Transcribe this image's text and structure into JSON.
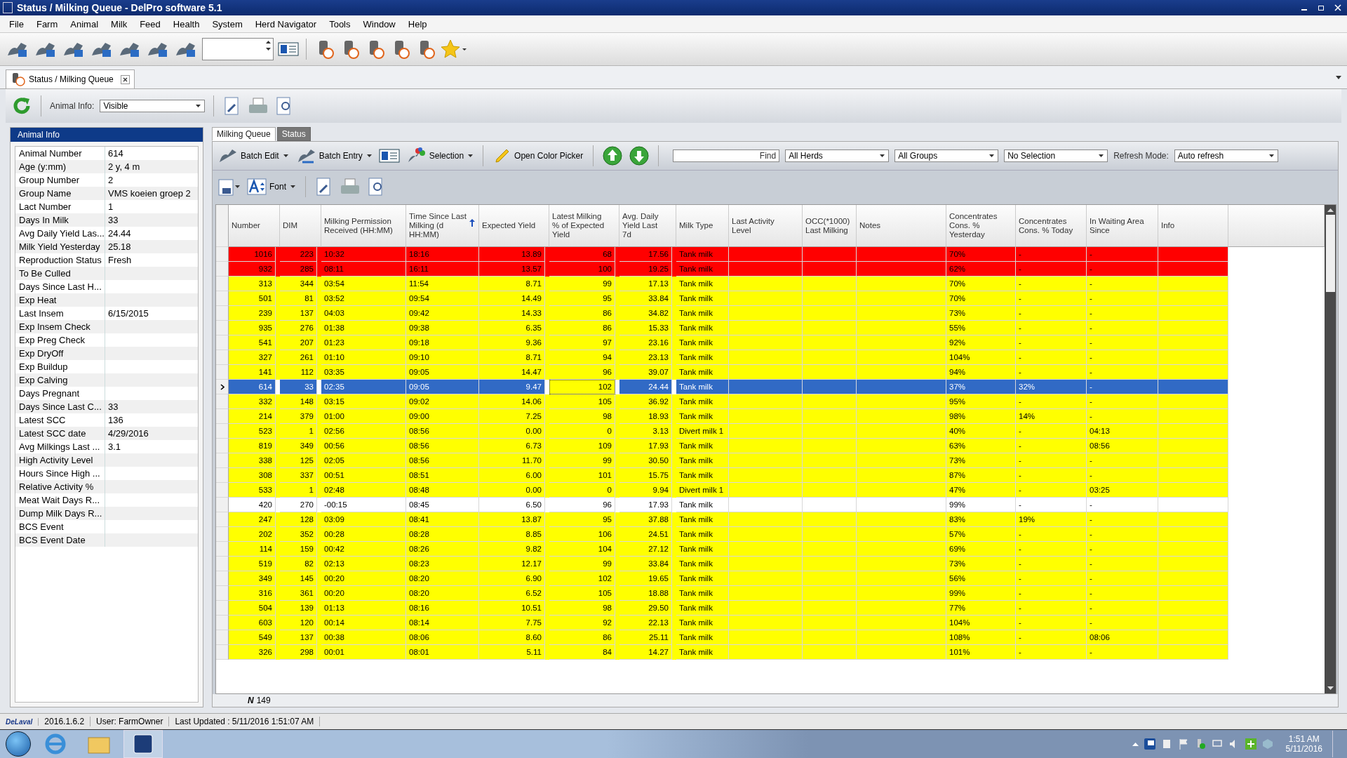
{
  "window": {
    "title": "Status / Milking Queue - DelPro software 5.1"
  },
  "menu": [
    "File",
    "Farm",
    "Animal",
    "Milk",
    "Feed",
    "Health",
    "System",
    "Herd Navigator",
    "Tools",
    "Window",
    "Help"
  ],
  "document_tab": {
    "label": "Status / Milking Queue"
  },
  "animal_info_selector": {
    "label": "Animal Info:",
    "value": "Visible"
  },
  "animal_info": {
    "title": "Animal Info",
    "fields": [
      {
        "label": "Animal Number",
        "value": "614"
      },
      {
        "label": "Age (y:mm)",
        "value": "2 y, 4 m"
      },
      {
        "label": "Group Number",
        "value": "2"
      },
      {
        "label": "Group Name",
        "value": "VMS koeien groep 2"
      },
      {
        "label": "Lact Number",
        "value": "1"
      },
      {
        "label": "Days In Milk",
        "value": "33"
      },
      {
        "label": "Avg Daily Yield Las...",
        "value": "24.44"
      },
      {
        "label": "Milk Yield Yesterday",
        "value": "25.18"
      },
      {
        "label": "Reproduction Status",
        "value": "Fresh"
      },
      {
        "label": "To Be Culled"
      },
      {
        "label": "Days Since Last H..."
      },
      {
        "label": "Exp Heat"
      },
      {
        "label": "Last Insem",
        "value": "6/15/2015"
      },
      {
        "label": "Exp Insem Check"
      },
      {
        "label": "Exp Preg Check"
      },
      {
        "label": "Exp DryOff"
      },
      {
        "label": "Exp Buildup"
      },
      {
        "label": "Exp Calving"
      },
      {
        "label": "Days Pregnant"
      },
      {
        "label": "Days Since Last C...",
        "value": "33"
      },
      {
        "label": "Latest SCC",
        "value": "136"
      },
      {
        "label": "Latest SCC date",
        "value": "4/29/2016"
      },
      {
        "label": "Avg Milkings Last ...",
        "value": "3.1"
      },
      {
        "label": "High Activity Level"
      },
      {
        "label": "Hours Since High ..."
      },
      {
        "label": "Relative Activity %"
      },
      {
        "label": "Meat Wait Days R..."
      },
      {
        "label": "Dump Milk Days R..."
      },
      {
        "label": "BCS Event"
      },
      {
        "label": "BCS Event Date"
      }
    ]
  },
  "view_tabs": [
    {
      "label": "Milking Queue",
      "selected": true
    },
    {
      "label": "Status",
      "selected": false
    }
  ],
  "grid_toolbar": {
    "batch_edit": "Batch Edit",
    "batch_entry": "Batch Entry",
    "selection": "Selection",
    "color_picker": "Open Color Picker",
    "find": "Find",
    "filters": [
      "All Herds",
      "All Groups",
      "No Selection"
    ],
    "refresh_label": "Refresh Mode:",
    "refresh_value": "Auto refresh",
    "font": "Font"
  },
  "table": {
    "columns": [
      {
        "label": "Number"
      },
      {
        "label": "DIM"
      },
      {
        "label": "Milking Permission Received (HH:MM)"
      },
      {
        "label": "Time Since Last Milking (d HH:MM)",
        "sorted": true
      },
      {
        "label": "Expected Yield"
      },
      {
        "label": "Latest Milking % of Expected Yield"
      },
      {
        "label": "Avg. Daily Yield Last 7d"
      },
      {
        "label": "Milk Type"
      },
      {
        "label": "Last Activity Level"
      },
      {
        "label": "OCC(*1000) Last Milking"
      },
      {
        "label": "Notes"
      },
      {
        "label": "Concentrates Cons. % Yesterday"
      },
      {
        "label": "Concentrates Cons. % Today"
      },
      {
        "label": "In Waiting Area Since"
      },
      {
        "label": "Info"
      }
    ],
    "rows": [
      {
        "number": "1016",
        "dim": "223",
        "permission": "10:32",
        "since_last": "18:16",
        "expected": "13.89",
        "latest_pct": "68",
        "avg_7d": "17.56",
        "milk_type": "Tank milk",
        "conc_yesterday": "70%",
        "conc_today": "-",
        "waiting": "-",
        "color": "#ff0000",
        "selected": false
      },
      {
        "number": "932",
        "dim": "285",
        "permission": "08:11",
        "since_last": "16:11",
        "expected": "13.57",
        "latest_pct": "100",
        "avg_7d": "19.25",
        "milk_type": "Tank milk",
        "conc_yesterday": "62%",
        "conc_today": "-",
        "waiting": "-",
        "color": "#ff0000",
        "selected": false
      },
      {
        "number": "313",
        "dim": "344",
        "permission": "03:54",
        "since_last": "11:54",
        "expected": "8.71",
        "latest_pct": "99",
        "avg_7d": "17.13",
        "milk_type": "Tank milk",
        "conc_yesterday": "70%",
        "conc_today": "-",
        "waiting": "-",
        "color": "#ffff00",
        "selected": false
      },
      {
        "number": "501",
        "dim": "81",
        "permission": "03:52",
        "since_last": "09:54",
        "expected": "14.49",
        "latest_pct": "95",
        "avg_7d": "33.84",
        "milk_type": "Tank milk",
        "conc_yesterday": "70%",
        "conc_today": "-",
        "waiting": "-",
        "color": "#ffff00",
        "selected": false
      },
      {
        "number": "239",
        "dim": "137",
        "permission": "04:03",
        "since_last": "09:42",
        "expected": "14.33",
        "latest_pct": "86",
        "avg_7d": "34.82",
        "milk_type": "Tank milk",
        "conc_yesterday": "73%",
        "conc_today": "-",
        "waiting": "-",
        "color": "#ffff00",
        "selected": false
      },
      {
        "number": "935",
        "dim": "276",
        "permission": "01:38",
        "since_last": "09:38",
        "expected": "6.35",
        "latest_pct": "86",
        "avg_7d": "15.33",
        "milk_type": "Tank milk",
        "conc_yesterday": "55%",
        "conc_today": "-",
        "waiting": "-",
        "color": "#ffff00",
        "selected": false
      },
      {
        "number": "541",
        "dim": "207",
        "permission": "01:23",
        "since_last": "09:18",
        "expected": "9.36",
        "latest_pct": "97",
        "avg_7d": "23.16",
        "milk_type": "Tank milk",
        "conc_yesterday": "92%",
        "conc_today": "-",
        "waiting": "-",
        "color": "#ffff00",
        "selected": false
      },
      {
        "number": "327",
        "dim": "261",
        "permission": "01:10",
        "since_last": "09:10",
        "expected": "8.71",
        "latest_pct": "94",
        "avg_7d": "23.13",
        "milk_type": "Tank milk",
        "conc_yesterday": "104%",
        "conc_today": "-",
        "waiting": "-",
        "color": "#ffff00",
        "selected": false
      },
      {
        "number": "141",
        "dim": "112",
        "permission": "03:35",
        "since_last": "09:05",
        "expected": "14.47",
        "latest_pct": "96",
        "avg_7d": "39.07",
        "milk_type": "Tank milk",
        "conc_yesterday": "94%",
        "conc_today": "-",
        "waiting": "-",
        "color": "#ffff00",
        "selected": false
      },
      {
        "number": "614",
        "dim": "33",
        "permission": "02:35",
        "since_last": "09:05",
        "expected": "9.47",
        "latest_pct": "102",
        "avg_7d": "24.44",
        "milk_type": "Tank milk",
        "conc_yesterday": "37%",
        "conc_today": "32%",
        "waiting": "-",
        "color": "#ffff00",
        "selected": true
      },
      {
        "number": "332",
        "dim": "148",
        "permission": "03:15",
        "since_last": "09:02",
        "expected": "14.06",
        "latest_pct": "105",
        "avg_7d": "36.92",
        "milk_type": "Tank milk",
        "conc_yesterday": "95%",
        "conc_today": "-",
        "waiting": "-",
        "color": "#ffff00",
        "selected": false
      },
      {
        "number": "214",
        "dim": "379",
        "permission": "01:00",
        "since_last": "09:00",
        "expected": "7.25",
        "latest_pct": "98",
        "avg_7d": "18.93",
        "milk_type": "Tank milk",
        "conc_yesterday": "98%",
        "conc_today": "14%",
        "waiting": "-",
        "color": "#ffff00",
        "selected": false
      },
      {
        "number": "523",
        "dim": "1",
        "permission": "02:56",
        "since_last": "08:56",
        "expected": "0.00",
        "latest_pct": "0",
        "avg_7d": "3.13",
        "milk_type": "Divert milk 1",
        "conc_yesterday": "40%",
        "conc_today": "-",
        "waiting": "04:13",
        "color": "#ffff00",
        "selected": false
      },
      {
        "number": "819",
        "dim": "349",
        "permission": "00:56",
        "since_last": "08:56",
        "expected": "6.73",
        "latest_pct": "109",
        "avg_7d": "17.93",
        "milk_type": "Tank milk",
        "conc_yesterday": "63%",
        "conc_today": "-",
        "waiting": "08:56",
        "color": "#ffff00",
        "selected": false
      },
      {
        "number": "338",
        "dim": "125",
        "permission": "02:05",
        "since_last": "08:56",
        "expected": "11.70",
        "latest_pct": "99",
        "avg_7d": "30.50",
        "milk_type": "Tank milk",
        "conc_yesterday": "73%",
        "conc_today": "-",
        "waiting": "-",
        "color": "#ffff00",
        "selected": false
      },
      {
        "number": "308",
        "dim": "337",
        "permission": "00:51",
        "since_last": "08:51",
        "expected": "6.00",
        "latest_pct": "101",
        "avg_7d": "15.75",
        "milk_type": "Tank milk",
        "conc_yesterday": "87%",
        "conc_today": "-",
        "waiting": "-",
        "color": "#ffff00",
        "selected": false
      },
      {
        "number": "533",
        "dim": "1",
        "permission": "02:48",
        "since_last": "08:48",
        "expected": "0.00",
        "latest_pct": "0",
        "avg_7d": "9.94",
        "milk_type": "Divert milk 1",
        "conc_yesterday": "47%",
        "conc_today": "-",
        "waiting": "03:25",
        "color": "#ffff00",
        "selected": false
      },
      {
        "number": "420",
        "dim": "270",
        "permission": "-00:15",
        "since_last": "08:45",
        "expected": "6.50",
        "latest_pct": "96",
        "avg_7d": "17.93",
        "milk_type": "Tank milk",
        "conc_yesterday": "99%",
        "conc_today": "-",
        "waiting": "-",
        "color": "#ffffff",
        "selected": false
      },
      {
        "number": "247",
        "dim": "128",
        "permission": "03:09",
        "since_last": "08:41",
        "expected": "13.87",
        "latest_pct": "95",
        "avg_7d": "37.88",
        "milk_type": "Tank milk",
        "conc_yesterday": "83%",
        "conc_today": "19%",
        "waiting": "-",
        "color": "#ffff00",
        "selected": false
      },
      {
        "number": "202",
        "dim": "352",
        "permission": "00:28",
        "since_last": "08:28",
        "expected": "8.85",
        "latest_pct": "106",
        "avg_7d": "24.51",
        "milk_type": "Tank milk",
        "conc_yesterday": "57%",
        "conc_today": "-",
        "waiting": "-",
        "color": "#ffff00",
        "selected": false
      },
      {
        "number": "114",
        "dim": "159",
        "permission": "00:42",
        "since_last": "08:26",
        "expected": "9.82",
        "latest_pct": "104",
        "avg_7d": "27.12",
        "milk_type": "Tank milk",
        "conc_yesterday": "69%",
        "conc_today": "-",
        "waiting": "-",
        "color": "#ffff00",
        "selected": false
      },
      {
        "number": "519",
        "dim": "82",
        "permission": "02:13",
        "since_last": "08:23",
        "expected": "12.17",
        "latest_pct": "99",
        "avg_7d": "33.84",
        "milk_type": "Tank milk",
        "conc_yesterday": "73%",
        "conc_today": "-",
        "waiting": "-",
        "color": "#ffff00",
        "selected": false
      },
      {
        "number": "349",
        "dim": "145",
        "permission": "00:20",
        "since_last": "08:20",
        "expected": "6.90",
        "latest_pct": "102",
        "avg_7d": "19.65",
        "milk_type": "Tank milk",
        "conc_yesterday": "56%",
        "conc_today": "-",
        "waiting": "-",
        "color": "#ffff00",
        "selected": false
      },
      {
        "number": "316",
        "dim": "361",
        "permission": "00:20",
        "since_last": "08:20",
        "expected": "6.52",
        "latest_pct": "105",
        "avg_7d": "18.88",
        "milk_type": "Tank milk",
        "conc_yesterday": "99%",
        "conc_today": "-",
        "waiting": "-",
        "color": "#ffff00",
        "selected": false
      },
      {
        "number": "504",
        "dim": "139",
        "permission": "01:13",
        "since_last": "08:16",
        "expected": "10.51",
        "latest_pct": "98",
        "avg_7d": "29.50",
        "milk_type": "Tank milk",
        "conc_yesterday": "77%",
        "conc_today": "-",
        "waiting": "-",
        "color": "#ffff00",
        "selected": false
      },
      {
        "number": "603",
        "dim": "120",
        "permission": "00:14",
        "since_last": "08:14",
        "expected": "7.75",
        "latest_pct": "92",
        "avg_7d": "22.13",
        "milk_type": "Tank milk",
        "conc_yesterday": "104%",
        "conc_today": "-",
        "waiting": "-",
        "color": "#ffff00",
        "selected": false
      },
      {
        "number": "549",
        "dim": "137",
        "permission": "00:38",
        "since_last": "08:06",
        "expected": "8.60",
        "latest_pct": "86",
        "avg_7d": "25.11",
        "milk_type": "Tank milk",
        "conc_yesterday": "108%",
        "conc_today": "-",
        "waiting": "08:06",
        "color": "#ffff00",
        "selected": false
      },
      {
        "number": "326",
        "dim": "298",
        "permission": "00:01",
        "since_last": "08:01",
        "expected": "5.11",
        "latest_pct": "84",
        "avg_7d": "14.27",
        "milk_type": "Tank milk",
        "conc_yesterday": "101%",
        "conc_today": "-",
        "waiting": "-",
        "color": "#ffff00",
        "selected": false
      }
    ],
    "footer": {
      "count_label": "N",
      "count": "149"
    }
  },
  "status_bar": {
    "brand": "DeLaval",
    "version": "2016.1.6.2",
    "user": "User: FarmOwner",
    "last_updated": "Last Updated : 5/11/2016 1:51:07 AM"
  },
  "taskbar": {
    "time": "1:51 AM",
    "date": "5/11/2016"
  }
}
